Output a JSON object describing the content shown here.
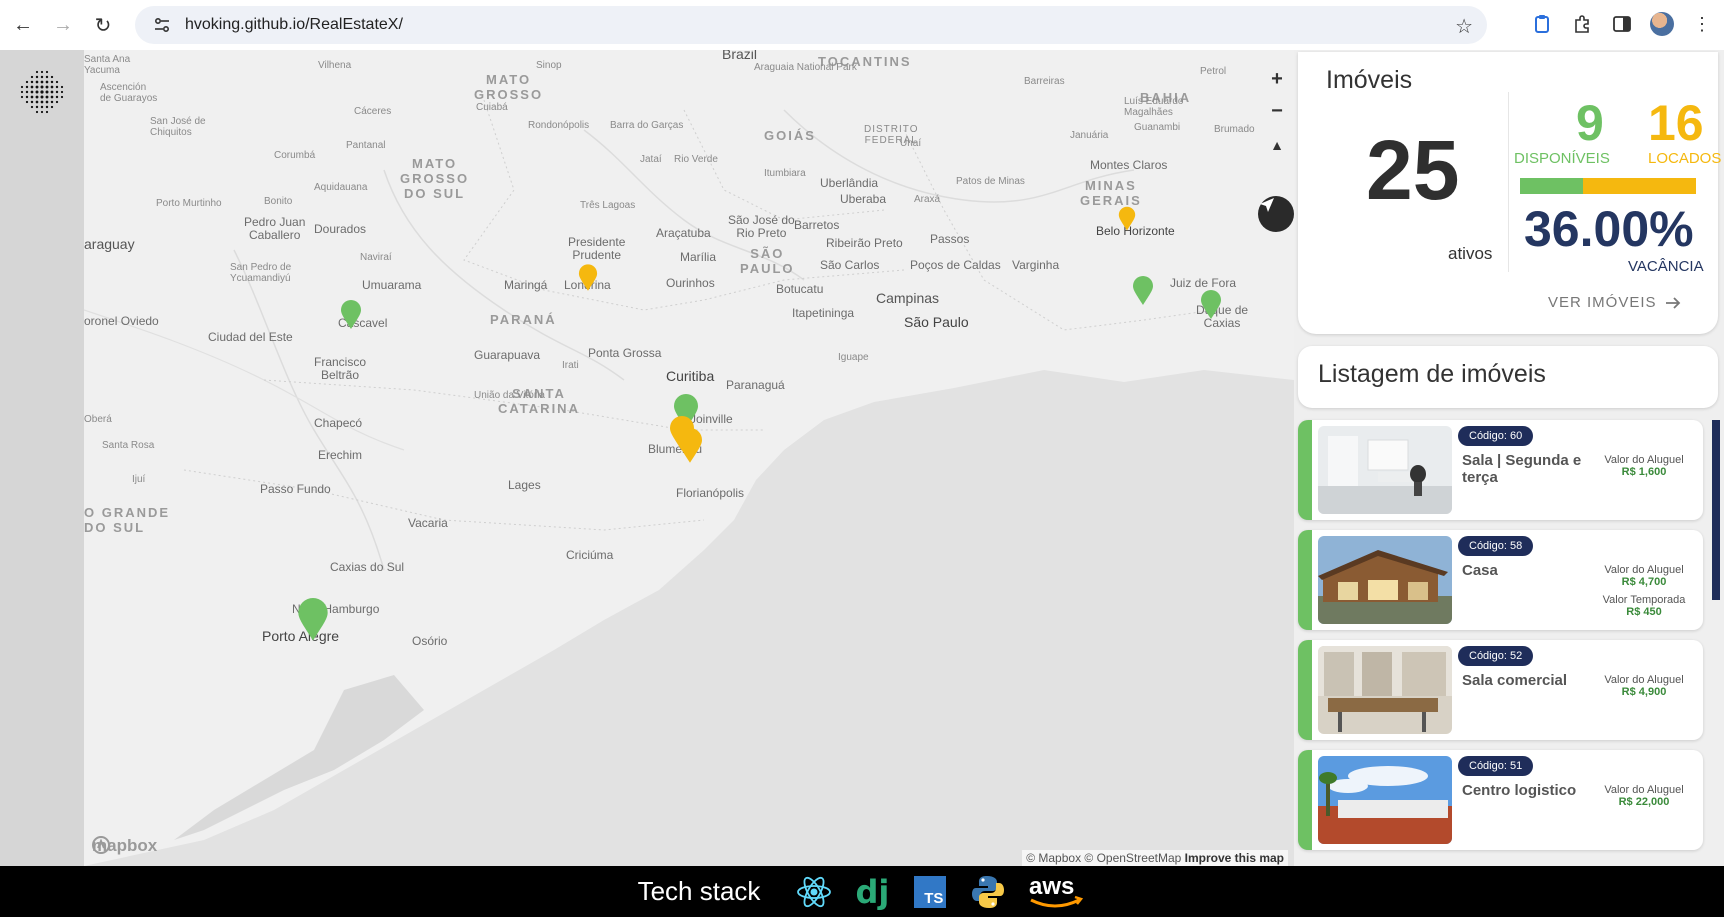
{
  "browser": {
    "url": "hvoking.github.io/RealEstateX/"
  },
  "map": {
    "labels": {
      "brazil": "Brazil",
      "tocantins": "TOCANTINS",
      "mato_grosso": "MATO\nGROSSO",
      "goias": "GOIÁS",
      "bahia": "BAHIA",
      "mato_grosso_sul": "MATO\nGROSSO\nDO SUL",
      "minas": "MINAS\nGERAIS",
      "sao_paulo_state": "SÃO\nPAULO",
      "parana": "PARANÁ",
      "santa_catarina": "SANTA\nCATARINA",
      "rio_grande": "O GRANDE\nDO SUL",
      "distrito": "DISTRITO\nFEDERAL",
      "paraguay": "araguay",
      "cities": {
        "sinop": "Sinop",
        "cuiaba": "Cuiabá",
        "rondonopolis": "Rondonópolis",
        "caceres": "Cáceres",
        "pantanal": "Pantanal",
        "corumba": "Corumbá",
        "aquidauana": "Aquidauana",
        "bonito": "Bonito",
        "pedro_juan": "Pedro Juan\nCaballero",
        "dourados": "Dourados",
        "navirai": "Naviraí",
        "umuarama": "Umuarama",
        "maringa": "Maringá",
        "londrina": "Londrina",
        "cascavel": "Cascavel",
        "ciudad_este": "Ciudad del Este",
        "coronel_oviedo": "oronel Oviedo",
        "san_pedro": "San Pedro de\nYcuamandiyú",
        "francisco_beltrao": "Francisco\nBeltrão",
        "guarapuava": "Guarapuava",
        "ponta_grossa": "Ponta Grossa",
        "curitiba": "Curitiba",
        "paranagua": "Paranaguá",
        "joinville": "Joinville",
        "blumenau": "Blumenau",
        "florianopolis": "Florianópolis",
        "lages": "Lages",
        "chapeco": "Chapecó",
        "erechim": "Erechim",
        "passo_fundo": "Passo Fundo",
        "vacaria": "Vacaria",
        "caxias": "Caxias do Sul",
        "criciuma": "Criciúma",
        "novo_hamburgo": "Novo Hamburgo",
        "porto_alegre": "Porto Alegre",
        "osorio": "Osório",
        "presidente_prudente": "Presidente\nPrudente",
        "aracatuba": "Araçatuba",
        "sao_jose_rio_preto": "São José do\nRio Preto",
        "marilia": "Marília",
        "ourinhos": "Ourinhos",
        "botucatu": "Botucatu",
        "campinas": "Campinas",
        "sao_paulo": "São Paulo",
        "sao_carlos": "São Carlos",
        "ribeirao": "Ribeirão Preto",
        "barretos": "Barretos",
        "uberaba": "Uberaba",
        "uberlandia": "Uberlândia",
        "itumbiara": "Itumbiara",
        "rio_verde": "Rio Verde",
        "jatai": "Jataí",
        "passos": "Passos",
        "pocos": "Poços de Caldas",
        "varginha": "Varginha",
        "belo_horizonte": "Belo Horizonte",
        "juiz_de_fora": "Juiz de Fora",
        "duque_caxias": "Duque de\nCaxias",
        "montes_claros": "Montes Claros",
        "guanambi": "Guanambi",
        "brumado": "Brumado",
        "itapetininga": "Itapetininga",
        "barra_garcas": "Barra do Garças",
        "patos": "Patos de Minas",
        "araxa": "Araxá",
        "ascencion": "Ascención\nde Guarayos",
        "san_jose_chiquitos": "San José de\nChiquitos",
        "santa_rosa": "Santa Rosa",
        "ijui": "Ijuí",
        "obera": "Oberá",
        "uniao": "União da Vitória",
        "irati": "Irati",
        "porto_murtinho": "Porto Murtinho",
        "tres_lagoas": "Três Lagoas",
        "vilhena": "Vilhena",
        "petrol": "Petrol",
        "lucas": "Luís Eduardo\nMagalhães",
        "iguape": "Iguape",
        "unai": "Unaí",
        "sta_ana": "Santa Ana\nYacuma",
        "araguaia": "Araguaia National Park",
        "barreiras": "Barreiras",
        "januaria": "Januária"
      },
      "attribution": "© Mapbox © OpenStreetMap",
      "improve": "Improve this map",
      "mapbox": "mapbox"
    }
  },
  "stats": {
    "title": "Imóveis",
    "total": "25",
    "total_label": "ativos",
    "available": "9",
    "available_label": "DISPONÍVEIS",
    "rented": "16",
    "rented_label": "LOCADOS",
    "available_fraction": 0.36,
    "vacancy": "36.00%",
    "vacancy_label": "VACÂNCIA",
    "view_link": "VER IMÓVEIS"
  },
  "listing_panel": {
    "title": "Listagem de imóveis",
    "items": [
      {
        "code": "Código: 60",
        "name": "Sala | Segunda e terça",
        "price_label": "Valor do Aluguel",
        "price": "R$ 1,600"
      },
      {
        "code": "Código: 58",
        "name": "Casa",
        "price_label": "Valor do Aluguel",
        "price": "R$ 4,700",
        "price2_label": "Valor Temporada",
        "price2": "R$ 450"
      },
      {
        "code": "Código: 52",
        "name": "Sala comercial",
        "price_label": "Valor do Aluguel",
        "price": "R$ 4,900"
      },
      {
        "code": "Código: 51",
        "name": "Centro logistico",
        "price_label": "Valor do Aluguel",
        "price": "R$ 22,000"
      }
    ]
  },
  "footer": {
    "tech_stack": "Tech stack",
    "icons": [
      "react-icon",
      "django-icon",
      "typescript-icon",
      "python-icon",
      "aws-icon"
    ],
    "dj": "dj",
    "ts": "TS",
    "aws": "aws"
  },
  "colors": {
    "available": "#6ec163",
    "rented": "#f5b80f",
    "navy": "#1f2d5a"
  }
}
